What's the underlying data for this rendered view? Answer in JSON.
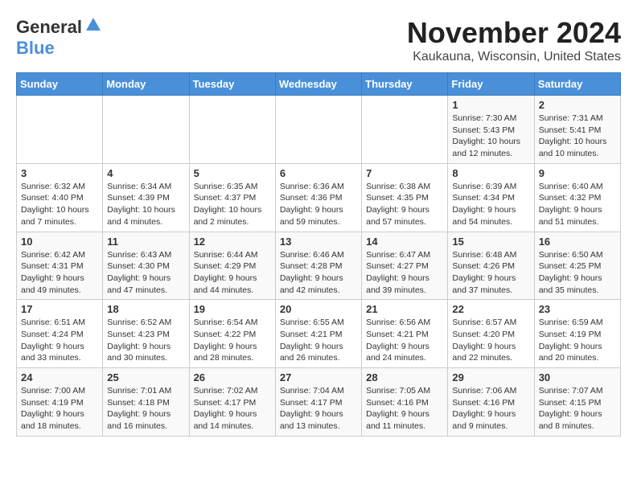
{
  "header": {
    "logo_line1": "General",
    "logo_line2": "Blue",
    "title": "November 2024",
    "subtitle": "Kaukauna, Wisconsin, United States"
  },
  "days_of_week": [
    "Sunday",
    "Monday",
    "Tuesday",
    "Wednesday",
    "Thursday",
    "Friday",
    "Saturday"
  ],
  "weeks": [
    [
      {
        "day": "",
        "info": ""
      },
      {
        "day": "",
        "info": ""
      },
      {
        "day": "",
        "info": ""
      },
      {
        "day": "",
        "info": ""
      },
      {
        "day": "",
        "info": ""
      },
      {
        "day": "1",
        "info": "Sunrise: 7:30 AM\nSunset: 5:43 PM\nDaylight: 10 hours and 12 minutes."
      },
      {
        "day": "2",
        "info": "Sunrise: 7:31 AM\nSunset: 5:41 PM\nDaylight: 10 hours and 10 minutes."
      }
    ],
    [
      {
        "day": "3",
        "info": "Sunrise: 6:32 AM\nSunset: 4:40 PM\nDaylight: 10 hours and 7 minutes."
      },
      {
        "day": "4",
        "info": "Sunrise: 6:34 AM\nSunset: 4:39 PM\nDaylight: 10 hours and 4 minutes."
      },
      {
        "day": "5",
        "info": "Sunrise: 6:35 AM\nSunset: 4:37 PM\nDaylight: 10 hours and 2 minutes."
      },
      {
        "day": "6",
        "info": "Sunrise: 6:36 AM\nSunset: 4:36 PM\nDaylight: 9 hours and 59 minutes."
      },
      {
        "day": "7",
        "info": "Sunrise: 6:38 AM\nSunset: 4:35 PM\nDaylight: 9 hours and 57 minutes."
      },
      {
        "day": "8",
        "info": "Sunrise: 6:39 AM\nSunset: 4:34 PM\nDaylight: 9 hours and 54 minutes."
      },
      {
        "day": "9",
        "info": "Sunrise: 6:40 AM\nSunset: 4:32 PM\nDaylight: 9 hours and 51 minutes."
      }
    ],
    [
      {
        "day": "10",
        "info": "Sunrise: 6:42 AM\nSunset: 4:31 PM\nDaylight: 9 hours and 49 minutes."
      },
      {
        "day": "11",
        "info": "Sunrise: 6:43 AM\nSunset: 4:30 PM\nDaylight: 9 hours and 47 minutes."
      },
      {
        "day": "12",
        "info": "Sunrise: 6:44 AM\nSunset: 4:29 PM\nDaylight: 9 hours and 44 minutes."
      },
      {
        "day": "13",
        "info": "Sunrise: 6:46 AM\nSunset: 4:28 PM\nDaylight: 9 hours and 42 minutes."
      },
      {
        "day": "14",
        "info": "Sunrise: 6:47 AM\nSunset: 4:27 PM\nDaylight: 9 hours and 39 minutes."
      },
      {
        "day": "15",
        "info": "Sunrise: 6:48 AM\nSunset: 4:26 PM\nDaylight: 9 hours and 37 minutes."
      },
      {
        "day": "16",
        "info": "Sunrise: 6:50 AM\nSunset: 4:25 PM\nDaylight: 9 hours and 35 minutes."
      }
    ],
    [
      {
        "day": "17",
        "info": "Sunrise: 6:51 AM\nSunset: 4:24 PM\nDaylight: 9 hours and 33 minutes."
      },
      {
        "day": "18",
        "info": "Sunrise: 6:52 AM\nSunset: 4:23 PM\nDaylight: 9 hours and 30 minutes."
      },
      {
        "day": "19",
        "info": "Sunrise: 6:54 AM\nSunset: 4:22 PM\nDaylight: 9 hours and 28 minutes."
      },
      {
        "day": "20",
        "info": "Sunrise: 6:55 AM\nSunset: 4:21 PM\nDaylight: 9 hours and 26 minutes."
      },
      {
        "day": "21",
        "info": "Sunrise: 6:56 AM\nSunset: 4:21 PM\nDaylight: 9 hours and 24 minutes."
      },
      {
        "day": "22",
        "info": "Sunrise: 6:57 AM\nSunset: 4:20 PM\nDaylight: 9 hours and 22 minutes."
      },
      {
        "day": "23",
        "info": "Sunrise: 6:59 AM\nSunset: 4:19 PM\nDaylight: 9 hours and 20 minutes."
      }
    ],
    [
      {
        "day": "24",
        "info": "Sunrise: 7:00 AM\nSunset: 4:19 PM\nDaylight: 9 hours and 18 minutes."
      },
      {
        "day": "25",
        "info": "Sunrise: 7:01 AM\nSunset: 4:18 PM\nDaylight: 9 hours and 16 minutes."
      },
      {
        "day": "26",
        "info": "Sunrise: 7:02 AM\nSunset: 4:17 PM\nDaylight: 9 hours and 14 minutes."
      },
      {
        "day": "27",
        "info": "Sunrise: 7:04 AM\nSunset: 4:17 PM\nDaylight: 9 hours and 13 minutes."
      },
      {
        "day": "28",
        "info": "Sunrise: 7:05 AM\nSunset: 4:16 PM\nDaylight: 9 hours and 11 minutes."
      },
      {
        "day": "29",
        "info": "Sunrise: 7:06 AM\nSunset: 4:16 PM\nDaylight: 9 hours and 9 minutes."
      },
      {
        "day": "30",
        "info": "Sunrise: 7:07 AM\nSunset: 4:15 PM\nDaylight: 9 hours and 8 minutes."
      }
    ]
  ]
}
